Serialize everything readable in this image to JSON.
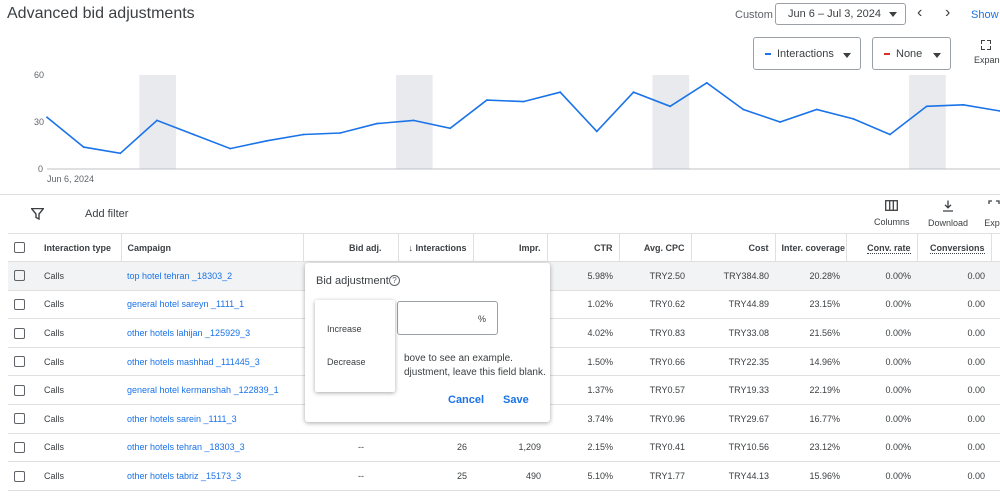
{
  "header": {
    "title": "Advanced bid adjustments",
    "range_label": "Custom",
    "date_range": "Jun 6 – Jul 3, 2024",
    "prev_icon": "chevron-left-icon",
    "next_icon": "chevron-right-icon",
    "show_label": "Show l"
  },
  "metrics": {
    "primary": {
      "label": "Interactions",
      "color": "#1a73e8"
    },
    "secondary": {
      "label": "None",
      "color": "#d93025"
    },
    "expand_label": "Expand"
  },
  "chart_data": {
    "type": "line",
    "x_start_label": "Jun 6, 2024",
    "y_ticks": [
      "60",
      "30",
      "0"
    ],
    "ylim": [
      0,
      60
    ],
    "series": [
      {
        "values": [
          33,
          14,
          10,
          31,
          22,
          13,
          18,
          22,
          23,
          29,
          31,
          26,
          44,
          43,
          49,
          24,
          49,
          40,
          55,
          38,
          30,
          38,
          32,
          22,
          40,
          41,
          37
        ]
      }
    ],
    "color": "#1a73e8",
    "weekend_bands": [
      3,
      10,
      17,
      24
    ]
  },
  "toolbar": {
    "filter_icon": "filter-icon",
    "add_filter": "Add filter",
    "columns": "Columns",
    "download": "Download",
    "expand": "Exp"
  },
  "table": {
    "headers": {
      "interaction_type": "Interaction type",
      "campaign": "Campaign",
      "bid_adj": "Bid adj.",
      "interactions": "↓ Interactions",
      "impr": "Impr.",
      "ctr": "CTR",
      "avg_cpc": "Avg. CPC",
      "cost": "Cost",
      "inter_coverage": "Inter. coverage",
      "conv_rate": "Conv. rate",
      "conversions": "Conversions"
    },
    "rows": [
      {
        "type": "Calls",
        "campaign": "top hotel tehran _18303_2",
        "bid": "",
        "interactions": "",
        "impr": "",
        "ctr": "5.98%",
        "cpc": "TRY2.50",
        "cost": "TRY384.80",
        "coverage": "20.28%",
        "conv_rate": "0.00%",
        "conversions": "0.00"
      },
      {
        "type": "Calls",
        "campaign": "general hotel sareyn _1111_1",
        "bid": "",
        "interactions": "",
        "impr": "",
        "ctr": "1.02%",
        "cpc": "TRY0.62",
        "cost": "TRY44.89",
        "coverage": "23.15%",
        "conv_rate": "0.00%",
        "conversions": "0.00"
      },
      {
        "type": "Calls",
        "campaign": "other hotels lahijan _125929_3",
        "bid": "",
        "interactions": "",
        "impr": "",
        "ctr": "4.02%",
        "cpc": "TRY0.83",
        "cost": "TRY33.08",
        "coverage": "21.56%",
        "conv_rate": "0.00%",
        "conversions": "0.00"
      },
      {
        "type": "Calls",
        "campaign": "other hotels mashhad _111445_3",
        "bid": "",
        "interactions": "",
        "impr": "",
        "ctr": "1.50%",
        "cpc": "TRY0.66",
        "cost": "TRY22.35",
        "coverage": "14.96%",
        "conv_rate": "0.00%",
        "conversions": "0.00"
      },
      {
        "type": "Calls",
        "campaign": "general hotel kermanshah _122839_1",
        "bid": "",
        "interactions": "",
        "impr": "",
        "ctr": "1.37%",
        "cpc": "TRY0.57",
        "cost": "TRY19.33",
        "coverage": "22.19%",
        "conv_rate": "0.00%",
        "conversions": "0.00"
      },
      {
        "type": "Calls",
        "campaign": "other hotels sarein _1111_3",
        "bid": "",
        "interactions": "",
        "impr": "",
        "ctr": "3.74%",
        "cpc": "TRY0.96",
        "cost": "TRY29.67",
        "coverage": "16.77%",
        "conv_rate": "0.00%",
        "conversions": "0.00"
      },
      {
        "type": "Calls",
        "campaign": "other hotels tehran _18303_3",
        "bid": "--",
        "interactions": "26",
        "impr": "1,209",
        "ctr": "2.15%",
        "cpc": "TRY0.41",
        "cost": "TRY10.56",
        "coverage": "23.12%",
        "conv_rate": "0.00%",
        "conversions": "0.00"
      },
      {
        "type": "Calls",
        "campaign": "other hotels tabriz _15173_3",
        "bid": "--",
        "interactions": "25",
        "impr": "490",
        "ctr": "5.10%",
        "cpc": "TRY1.77",
        "cost": "TRY44.13",
        "coverage": "15.96%",
        "conv_rate": "0.00%",
        "conversions": "0.00"
      }
    ]
  },
  "popup": {
    "title": "Bid adjustment",
    "help_icon": "help-circle-icon",
    "input_value": "",
    "input_suffix": "%",
    "help_line_1": "bove to see an example.",
    "help_line_2": "djustment, leave this field blank.",
    "cancel": "Cancel",
    "save": "Save",
    "menu": {
      "increase": "Increase",
      "decrease": "Decrease"
    }
  }
}
